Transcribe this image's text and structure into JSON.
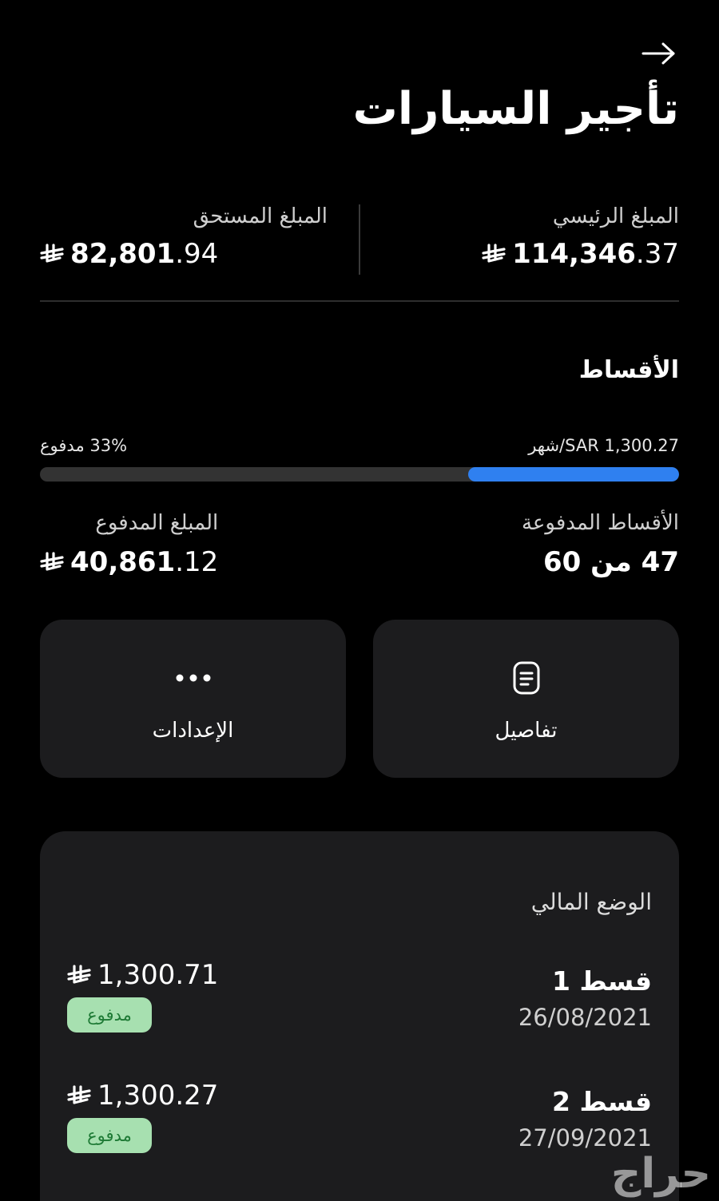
{
  "header": {
    "back_icon": "arrow-right-icon",
    "title": "تأجير السيارات"
  },
  "amounts": {
    "principal": {
      "label": "المبلغ الرئيسي",
      "whole": "114,346",
      "decimal": ".37"
    },
    "due": {
      "label": "المبلغ المستحق",
      "whole": "82,801",
      "decimal": ".94"
    },
    "currency_icon": "saudi-riyal-icon"
  },
  "installments": {
    "title": "الأقساط",
    "monthly": "SAR 1,300.27/شهر",
    "paid_percent_label": "33% مدفوع",
    "progress_fraction": 0.33,
    "paid_count": {
      "label": "الأقساط المدفوعة",
      "value": "47 من 60"
    },
    "paid_amount": {
      "label": "المبلغ المدفوع",
      "whole": "40,861",
      "decimal": ".12"
    }
  },
  "actions": [
    {
      "label": "تفاصيل",
      "icon": "document-icon"
    },
    {
      "label": "الإعدادات",
      "icon": "more-dots-icon"
    }
  ],
  "financial_status": {
    "title": "الوضع المالي",
    "items": [
      {
        "name": "قسط 1",
        "date": "26/08/2021",
        "whole": "1,300",
        "decimal": ".71",
        "status": "مدفوع"
      },
      {
        "name": "قسط 2",
        "date": "27/09/2021",
        "whole": "1,300",
        "decimal": ".27",
        "status": "مدفوع"
      }
    ]
  },
  "watermark": "حراج",
  "colors": {
    "background": "#000000",
    "card": "#1c1c1e",
    "progress_fill": "#2f80f0",
    "progress_track": "#333333",
    "badge_bg": "#a7e0b0",
    "badge_text": "#1e7a35"
  }
}
